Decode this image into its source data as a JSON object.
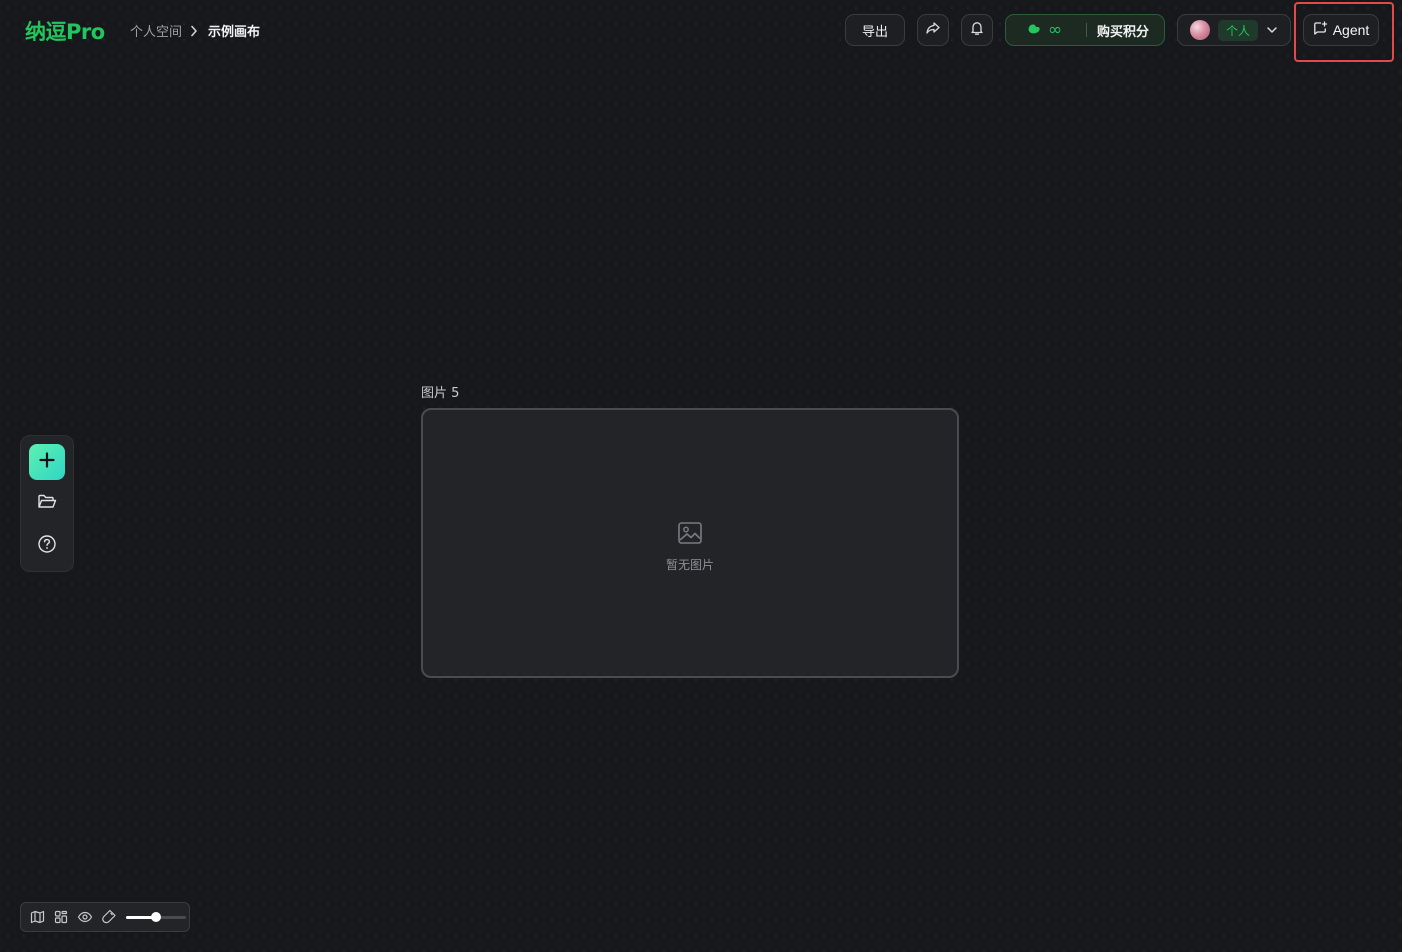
{
  "app": {
    "logo": "纳逗Pro"
  },
  "breadcrumb": {
    "parent": "个人空间",
    "current": "示例画布"
  },
  "header": {
    "export_label": "导出",
    "credits_value": "∞",
    "buy_credits_label": "购买积分",
    "profile_badge": "个人",
    "agent_label": "Agent"
  },
  "icons": {
    "share": "share-arrow-icon",
    "bell": "bell-icon",
    "credits": "bean-icon",
    "chevron": "chevron-down-icon",
    "agent": "agent-chat-icon",
    "add": "plus-icon",
    "folder": "folder-open-icon",
    "help": "help-circle-icon",
    "map": "map-icon",
    "layout": "layout-icon",
    "eye": "eye-icon",
    "magnet": "magnet-icon"
  },
  "canvas": {
    "node_label": "图片 5",
    "empty_text": "暂无图片"
  },
  "zoom": {
    "level": 0.5
  },
  "colors": {
    "brand": "#22c55e",
    "highlight": "#e24a4a",
    "add_button": "#3ee0bd"
  }
}
